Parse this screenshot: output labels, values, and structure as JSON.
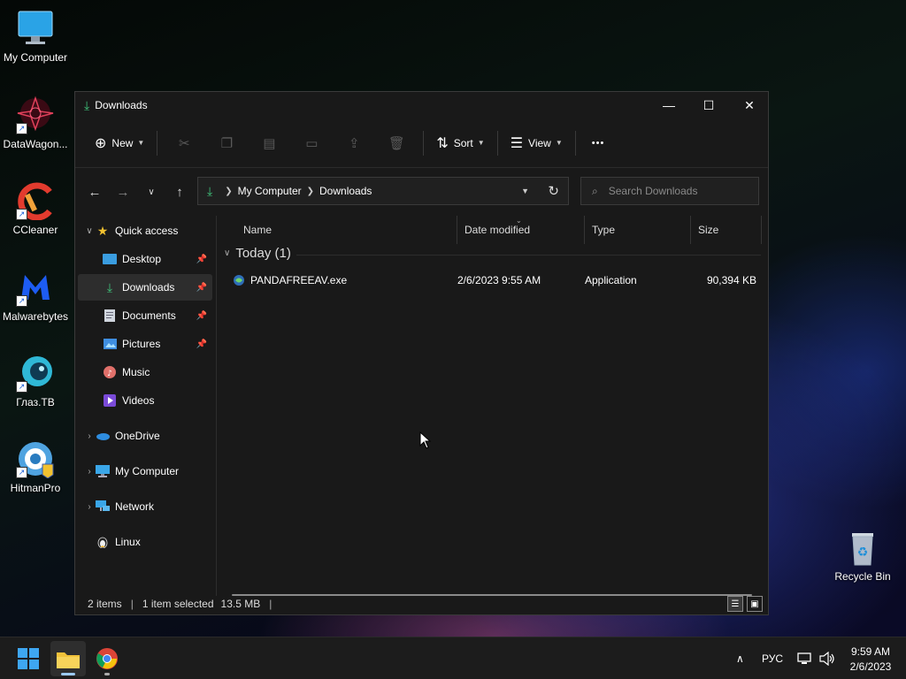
{
  "desktop": {
    "icons": [
      {
        "label": "My Computer",
        "icon": "monitor-icon"
      },
      {
        "label": "DataWagon...",
        "icon": "datawagon-icon"
      },
      {
        "label": "CCleaner",
        "icon": "ccleaner-icon"
      },
      {
        "label": "Malwarebytes",
        "icon": "malwarebytes-icon"
      },
      {
        "label": "Глаз.ТВ",
        "icon": "glaz-tv-icon"
      },
      {
        "label": "HitmanPro",
        "icon": "hitmanpro-icon"
      },
      {
        "label": "Recycle Bin",
        "icon": "recycle-bin-icon"
      }
    ]
  },
  "window": {
    "title": "Downloads",
    "controls": {
      "minimize": "—",
      "maximize": "☐",
      "close": "✕"
    },
    "toolbar": {
      "new_label": "New",
      "sort_label": "Sort",
      "view_label": "View",
      "more_label": "•••"
    },
    "address": {
      "segments": [
        "My Computer",
        "Downloads"
      ]
    },
    "search": {
      "placeholder": "Search Downloads"
    },
    "sidebar": {
      "quick_access": "Quick access",
      "items": [
        {
          "label": "Desktop",
          "icon": "desktop-icon",
          "pinned": true
        },
        {
          "label": "Downloads",
          "icon": "downloads-icon",
          "pinned": true,
          "selected": true
        },
        {
          "label": "Documents",
          "icon": "documents-icon",
          "pinned": true
        },
        {
          "label": "Pictures",
          "icon": "pictures-icon",
          "pinned": true
        },
        {
          "label": "Music",
          "icon": "music-icon",
          "pinned": false
        },
        {
          "label": "Videos",
          "icon": "videos-icon",
          "pinned": false
        }
      ],
      "roots": [
        {
          "label": "OneDrive",
          "icon": "onedrive-icon"
        },
        {
          "label": "My Computer",
          "icon": "computer-icon"
        },
        {
          "label": "Network",
          "icon": "network-icon"
        },
        {
          "label": "Linux",
          "icon": "linux-icon"
        }
      ]
    },
    "columns": {
      "name": "Name",
      "date": "Date modified",
      "type": "Type",
      "size": "Size"
    },
    "group": {
      "label": "Today (1)"
    },
    "files": [
      {
        "name": "PANDAFREEAV.exe",
        "date": "2/6/2023 9:55 AM",
        "type": "Application",
        "size": "90,394 KB"
      }
    ],
    "status": {
      "items": "2 items",
      "selected": "1 item selected",
      "selected_size": "13.5 MB"
    }
  },
  "taskbar": {
    "language": "РУС",
    "time": "9:59 AM",
    "date": "2/6/2023"
  },
  "colors": {
    "accent_green": "#3fc27a",
    "window_bg": "#191919",
    "taskbar_bg": "#1c1c1c"
  }
}
